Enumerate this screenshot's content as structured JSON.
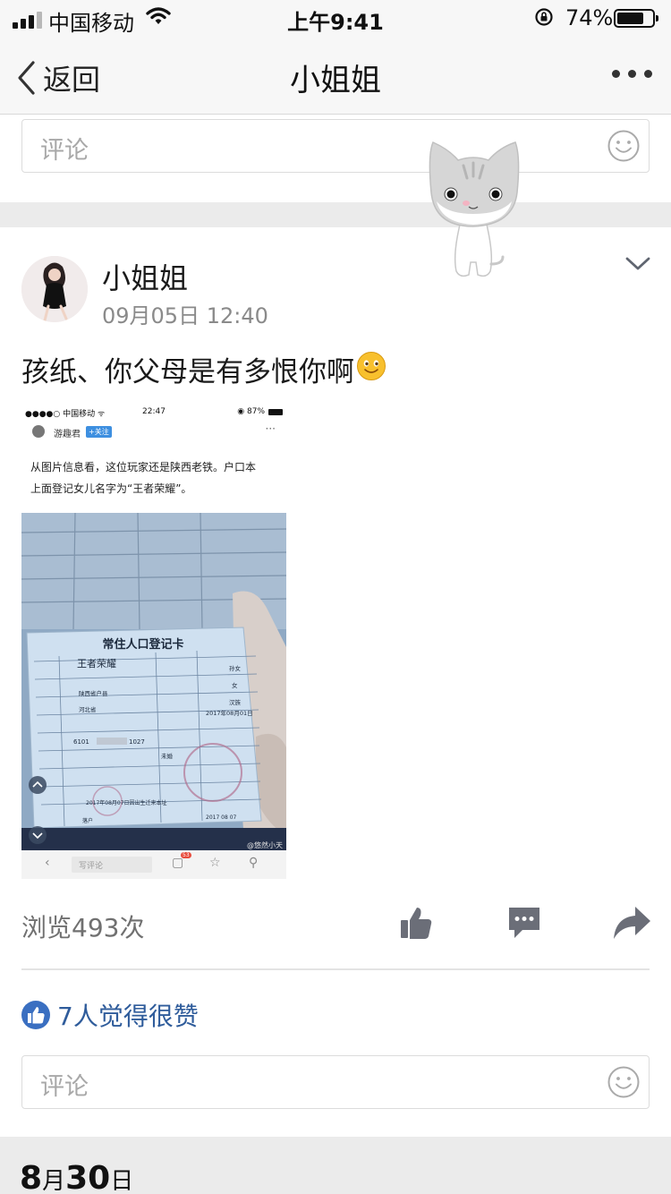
{
  "status_bar": {
    "carrier": "中国移动",
    "time": "上午9:41",
    "battery": "74%",
    "battery_level": 0.74
  },
  "nav": {
    "back_label": "返回",
    "title": "小姐姐",
    "back_icon": "chevron-left-icon",
    "more_icon": "more-dots-icon"
  },
  "top_comment": {
    "placeholder": "评论",
    "emoji_icon": "smiley-icon"
  },
  "post": {
    "author": "小姐姐",
    "time": "09月05日 12:40",
    "text": "孩纸、你父母是有多恨你啊",
    "screenshot": {
      "status_left": "●●●●○ 中国移动 ᯤ",
      "status_time": "22:47",
      "status_right": "◉ 87%",
      "account": "游趣君",
      "follow": "+关注",
      "line1": "从图片信息看，这位玩家还是陕西老铁。户口本",
      "line2": "上面登记女儿名字为“王者荣耀”。",
      "card_title": "常住人口登记卡",
      "card_name": "王者荣耀",
      "card_relation": "孙女",
      "card_gender": "女",
      "card_birthplace": "陕西省户县",
      "card_ethnicity": "汉族",
      "card_native": "河北省",
      "card_birthday": "2017年08月01日",
      "card_id_head": "6101",
      "card_id_tail": "1027",
      "card_marital": "未婚",
      "card_footer": "2017年08月07日因出生迁来本址",
      "card_hukou": "落户",
      "card_date": "2017  08  07",
      "watermark": "@悠然小天",
      "comment_placeholder": "写评论",
      "comment_count": "53"
    },
    "views": "浏览493次",
    "likes": "7人觉得很赞"
  },
  "bottom_comment": {
    "placeholder": "评论"
  },
  "next_date": {
    "day": "8",
    "month_unit": "月",
    "date": "30",
    "day_unit": "日"
  },
  "colors": {
    "link_blue": "#2f5c9b",
    "icon_gray": "#6b6e78",
    "like_blue": "#3a6fc1",
    "separator": "#ebebeb"
  }
}
